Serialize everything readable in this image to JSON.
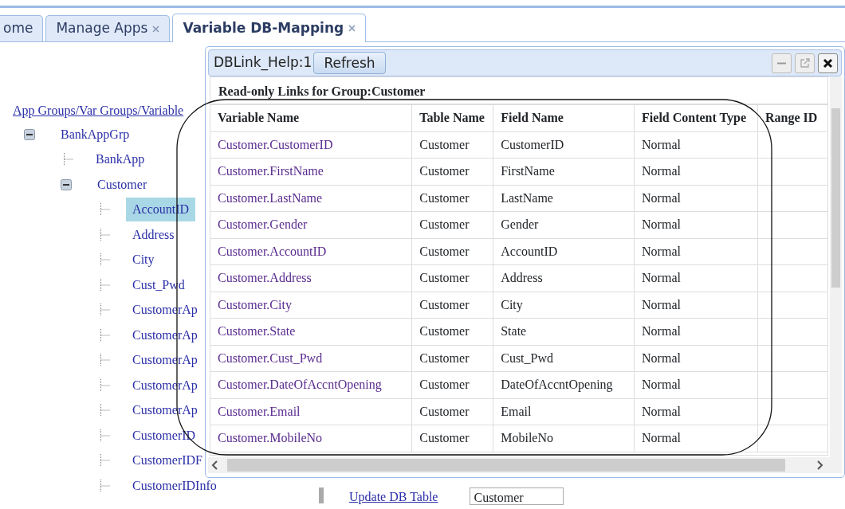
{
  "tabs": [
    {
      "label": "ome",
      "closable": false,
      "selected": false
    },
    {
      "label": "Manage Apps",
      "closable": true,
      "selected": false
    },
    {
      "label": "Variable DB-Mapping",
      "closable": true,
      "selected": true
    }
  ],
  "tree": {
    "root_link": "App Groups/Var Groups/Variable",
    "items": [
      {
        "label": "BankAppGrp",
        "expanded": true,
        "selected": false,
        "children": [
          {
            "label": "BankApp",
            "selected": false
          },
          {
            "label": "Customer",
            "expanded": true,
            "selected": false,
            "children": [
              {
                "label": "AccountID",
                "selected": true
              },
              {
                "label": "Address",
                "selected": false
              },
              {
                "label": "City",
                "selected": false
              },
              {
                "label": "Cust_Pwd",
                "selected": false
              },
              {
                "label": "CustomerAp",
                "selected": false
              },
              {
                "label": "CustomerAp",
                "selected": false
              },
              {
                "label": "CustomerAp",
                "selected": false
              },
              {
                "label": "CustomerAp",
                "selected": false
              },
              {
                "label": "CustomerAp",
                "selected": false
              },
              {
                "label": "CustomerID",
                "selected": false
              },
              {
                "label": "CustomerIDF",
                "selected": false
              },
              {
                "label": "CustomerIDInfo",
                "selected": false
              }
            ]
          }
        ]
      }
    ]
  },
  "background_form": {
    "link": "Update DB Table",
    "select_value": "Customer"
  },
  "dialog": {
    "title": "DBLink_Help:1",
    "refresh_button": "Refresh",
    "heading": "Read-only Links for Group:Customer",
    "columns": [
      "Variable Name",
      "Table Name",
      "Field Name",
      "Field Content Type",
      "Range ID"
    ],
    "rows": [
      {
        "variable": "Customer.CustomerID",
        "table": "Customer",
        "field": "CustomerID",
        "content_type": "Normal"
      },
      {
        "variable": "Customer.FirstName",
        "table": "Customer",
        "field": "FirstName",
        "content_type": "Normal"
      },
      {
        "variable": "Customer.LastName",
        "table": "Customer",
        "field": "LastName",
        "content_type": "Normal"
      },
      {
        "variable": "Customer.Gender",
        "table": "Customer",
        "field": "Gender",
        "content_type": "Normal"
      },
      {
        "variable": "Customer.AccountID",
        "table": "Customer",
        "field": "AccountID",
        "content_type": "Normal"
      },
      {
        "variable": "Customer.Address",
        "table": "Customer",
        "field": "Address",
        "content_type": "Normal"
      },
      {
        "variable": "Customer.City",
        "table": "Customer",
        "field": "City",
        "content_type": "Normal"
      },
      {
        "variable": "Customer.State",
        "table": "Customer",
        "field": "State",
        "content_type": "Normal"
      },
      {
        "variable": "Customer.Cust_Pwd",
        "table": "Customer",
        "field": "Cust_Pwd",
        "content_type": "Normal"
      },
      {
        "variable": "Customer.DateOfAccntOpening",
        "table": "Customer",
        "field": "DateOfAccntOpening",
        "content_type": "Normal"
      },
      {
        "variable": "Customer.Email",
        "table": "Customer",
        "field": "Email",
        "content_type": "Normal"
      },
      {
        "variable": "Customer.MobileNo",
        "table": "Customer",
        "field": "MobileNo",
        "content_type": "Normal"
      }
    ]
  }
}
